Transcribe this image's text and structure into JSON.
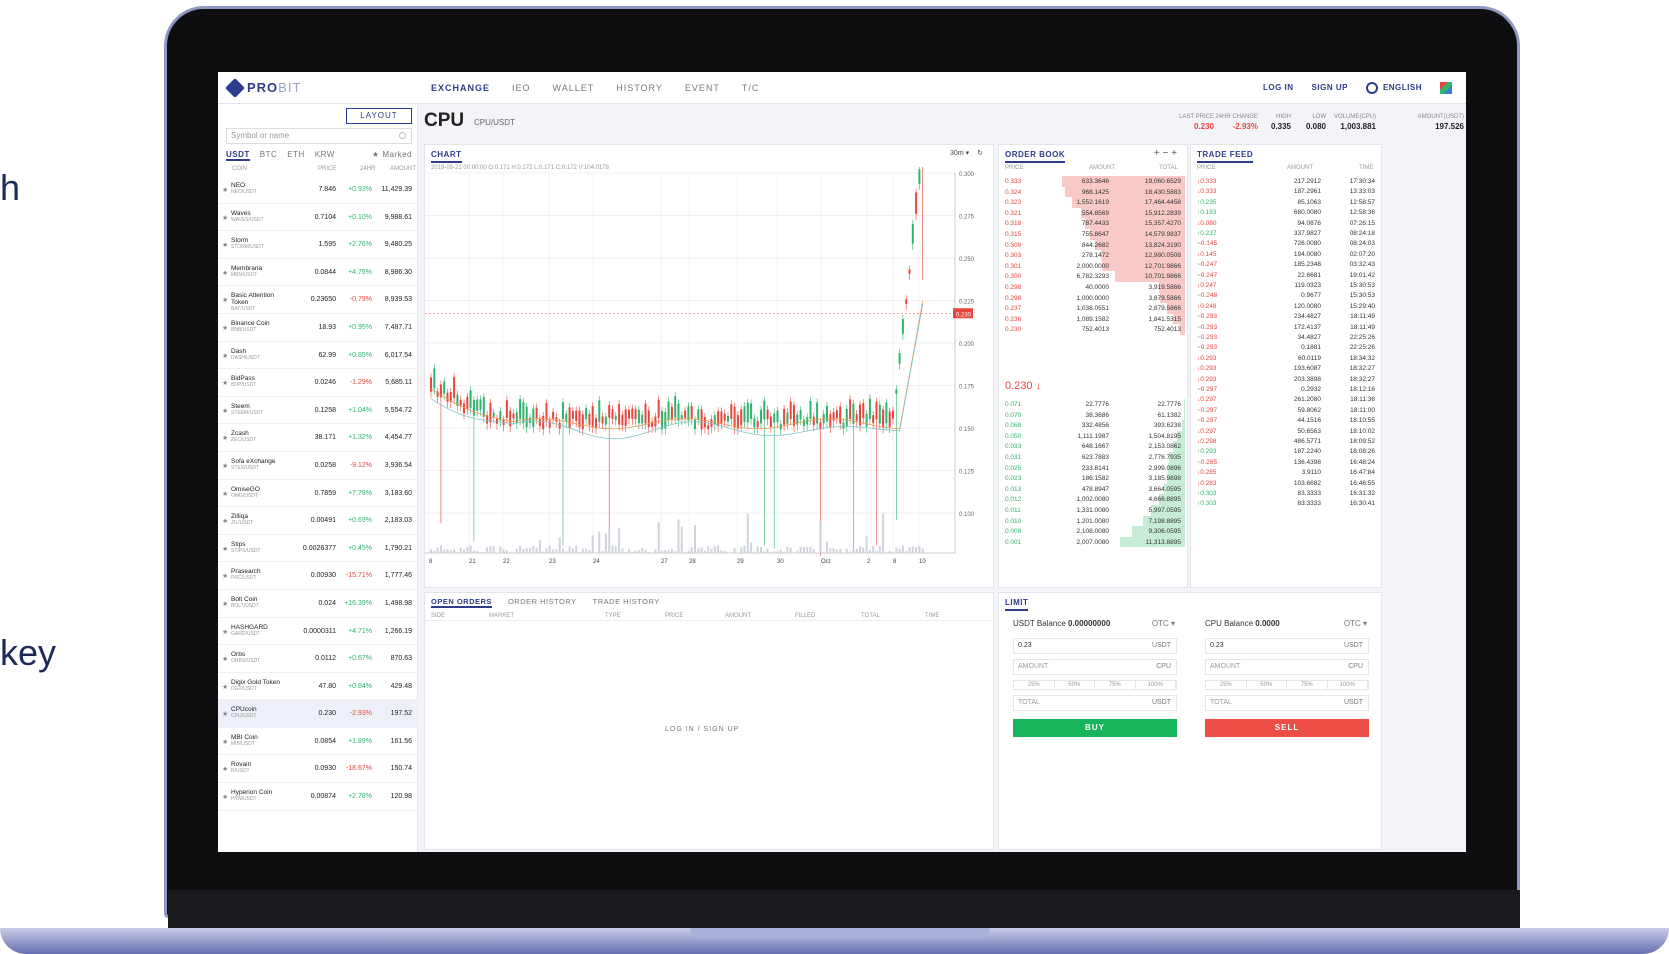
{
  "partial_side_text": {
    "line1": "h",
    "line2": "key"
  },
  "nav": {
    "logo_a": "PRO",
    "logo_b": "BIT",
    "tabs": [
      "EXCHANGE",
      "IEO",
      "WALLET",
      "HISTORY",
      "EVENT",
      "T/C"
    ],
    "login": "LOG IN",
    "signup": "SIGN UP",
    "language": "ENGLISH"
  },
  "markets": {
    "layout_button": "LAYOUT",
    "search_placeholder": "Symbol or name",
    "tabs": [
      "USDT",
      "BTC",
      "ETH",
      "KRW"
    ],
    "marked": "Marked",
    "headers": {
      "coin": "COIN",
      "price": "PRICE",
      "change": "24HR",
      "amount": "AMOUNT"
    },
    "coins": [
      {
        "name": "NEO",
        "pair": "NEO/USDT",
        "price": "7.846",
        "change": "+0.93%",
        "amount": "11,429.39",
        "dir": "up"
      },
      {
        "name": "Waves",
        "pair": "WAVES/USDT",
        "price": "0.7104",
        "change": "+0.10%",
        "amount": "9,988.61",
        "dir": "up"
      },
      {
        "name": "Storm",
        "pair": "STORM/USDT",
        "price": "1.595",
        "change": "+2.76%",
        "amount": "9,480.25",
        "dir": "up"
      },
      {
        "name": "Membrana",
        "pair": "MBN/USDT",
        "price": "0.0844",
        "change": "+4.76%",
        "amount": "8,986.30",
        "dir": "up"
      },
      {
        "name": "Basic Attention Token",
        "pair": "BAT/USDT",
        "price": "0.23650",
        "change": "-0.79%",
        "amount": "8,939.53",
        "dir": "dn"
      },
      {
        "name": "Binance Coin",
        "pair": "BNB/USDT",
        "price": "18.93",
        "change": "+0.95%",
        "amount": "7,487.71",
        "dir": "up"
      },
      {
        "name": "Dash",
        "pair": "DASH/USDT",
        "price": "62.99",
        "change": "+0.85%",
        "amount": "6,017.54",
        "dir": "up"
      },
      {
        "name": "BidPass",
        "pair": "BDP/USDT",
        "price": "0.0246",
        "change": "-1.29%",
        "amount": "5,685.11",
        "dir": "dn"
      },
      {
        "name": "Steem",
        "pair": "STEEM/USDT",
        "price": "0.1258",
        "change": "+1.04%",
        "amount": "5,554.72",
        "dir": "up"
      },
      {
        "name": "Zcash",
        "pair": "ZEC/USDT",
        "price": "38.171",
        "change": "+1.32%",
        "amount": "4,454.77",
        "dir": "up"
      },
      {
        "name": "Sofa eXchange",
        "pair": "STEX/USDT",
        "price": "0.0258",
        "change": "-9.12%",
        "amount": "3,936.54",
        "dir": "dn"
      },
      {
        "name": "OmiseGO",
        "pair": "OMG/USDT",
        "price": "0.7859",
        "change": "+7.78%",
        "amount": "3,183.60",
        "dir": "up"
      },
      {
        "name": "Zilliqa",
        "pair": "ZIL/USDT",
        "price": "0.00491",
        "change": "+0.69%",
        "amount": "2,183.03",
        "dir": "up"
      },
      {
        "name": "Stips",
        "pair": "STIPS/USDT",
        "price": "0.0026377",
        "change": "+0.45%",
        "amount": "1,790.21",
        "dir": "up"
      },
      {
        "name": "Prasearch",
        "pair": "PRC/USDT",
        "price": "0.00930",
        "change": "-15.71%",
        "amount": "1,777.46",
        "dir": "dn"
      },
      {
        "name": "Bolt Coin",
        "pair": "BOLT/USDT",
        "price": "0.024",
        "change": "+16.39%",
        "amount": "1,498.98",
        "dir": "up"
      },
      {
        "name": "HASHGARD",
        "pair": "GARD/USDT",
        "price": "0.0000311",
        "change": "+4.71%",
        "amount": "1,266.19",
        "dir": "up"
      },
      {
        "name": "Orbs",
        "pair": "ORBS/USDT",
        "price": "0.0112",
        "change": "+0.67%",
        "amount": "870.63",
        "dir": "up"
      },
      {
        "name": "Digix Gold Token",
        "pair": "DGX/USDT",
        "price": "47.80",
        "change": "+0.84%",
        "amount": "429.48",
        "dir": "up"
      },
      {
        "name": "CPUcoin",
        "pair": "CPU/USDT",
        "price": "0.230",
        "change": "-2.93%",
        "amount": "197.52",
        "dir": "dn"
      },
      {
        "name": "MBI Coin",
        "pair": "MIB/USDT",
        "price": "0.0854",
        "change": "+1.89%",
        "amount": "161.56",
        "dir": "up"
      },
      {
        "name": "Rovain",
        "pair": "R/USDT",
        "price": "0.0930",
        "change": "-18.67%",
        "amount": "150.74",
        "dir": "dn"
      },
      {
        "name": "Hyperion Coin",
        "pair": "HYN/USDT",
        "price": "0.00874",
        "change": "+2.78%",
        "amount": "120.98",
        "dir": "up"
      }
    ]
  },
  "ticker": {
    "symbol": "CPU",
    "pair": "CPU/USDT",
    "stats": [
      {
        "label": "LAST PRICE",
        "value": "0.230",
        "red": true
      },
      {
        "label": "24HR CHANGE",
        "value": "-2.93%",
        "red": true
      },
      {
        "label": "HIGH",
        "value": "0.335",
        "red": false
      },
      {
        "label": "LOW",
        "value": "0.080",
        "red": false
      },
      {
        "label": "VOLUME(CPU)",
        "value": "1,003.881",
        "red": false
      },
      {
        "label": "AMOUNT(USDT)",
        "value": "197.526",
        "red": false
      }
    ]
  },
  "chart": {
    "title": "CHART",
    "info": "2019-09-21 00:00:00  O:0.171  H:0.172  L:0.171  C:0.172  V:104.0178",
    "interval": "30m",
    "price_tag": "0.230",
    "y_ticks": [
      "0.300",
      "0.275",
      "0.250",
      "0.225",
      "0.200",
      "0.175",
      "0.150",
      "0.125",
      "0.100"
    ],
    "x_ticks": [
      "8",
      "21",
      "22",
      "23",
      "24",
      "27",
      "28",
      "29",
      "30",
      "Oct",
      "2",
      "8",
      "10"
    ]
  },
  "orderbook": {
    "title": "ORDER BOOK",
    "headers": {
      "price": "PRICE",
      "amount": "AMOUNT",
      "total": "TOTAL"
    },
    "asks": [
      {
        "p": "0.333",
        "a": "633.3646",
        "t": "19,060.6529",
        "d": 0.95
      },
      {
        "p": "0.324",
        "a": "968.1425",
        "t": "18,430.5883",
        "d": 0.92
      },
      {
        "p": "0.323",
        "a": "1,552.1619",
        "t": "17,464.4458",
        "d": 0.87
      },
      {
        "p": "0.321",
        "a": "554.8569",
        "t": "15,912.2839",
        "d": 0.8
      },
      {
        "p": "0.318",
        "a": "787.4433",
        "t": "15,357.4270",
        "d": 0.77
      },
      {
        "p": "0.315",
        "a": "755.8647",
        "t": "14,579.9837",
        "d": 0.73
      },
      {
        "p": "0.309",
        "a": "844.2682",
        "t": "13,824.3190",
        "d": 0.69
      },
      {
        "p": "0.303",
        "a": "278.1472",
        "t": "12,980.0508",
        "d": 0.65
      },
      {
        "p": "0.301",
        "a": "2,000.0000",
        "t": "12,701.9866",
        "d": 0.64
      },
      {
        "p": "0.300",
        "a": "6,782.3293",
        "t": "10,701.9866",
        "d": 0.54
      },
      {
        "p": "0.298",
        "a": "40.0000",
        "t": "3,919.5866",
        "d": 0.2
      },
      {
        "p": "0.298",
        "a": "1,000.0000",
        "t": "3,879.5866",
        "d": 0.19
      },
      {
        "p": "0.237",
        "a": "1,038.0551",
        "t": "2,879.5866",
        "d": 0.14
      },
      {
        "p": "0.236",
        "a": "1,089.1582",
        "t": "1,841.5315",
        "d": 0.09
      },
      {
        "p": "0.230",
        "a": "752.4013",
        "t": "752.4013",
        "d": 0.04
      }
    ],
    "mid": "0.230",
    "bids": [
      {
        "p": "0.071",
        "a": "22.7776",
        "t": "22.7776",
        "d": 0.01
      },
      {
        "p": "0.070",
        "a": "38.3686",
        "t": "61.1382",
        "d": 0.01
      },
      {
        "p": "0.068",
        "a": "332.4856",
        "t": "393.6238",
        "d": 0.02
      },
      {
        "p": "0.050",
        "a": "1,111.1987",
        "t": "1,504.8195",
        "d": 0.06
      },
      {
        "p": "0.033",
        "a": "648.1667",
        "t": "2,153.0862",
        "d": 0.09
      },
      {
        "p": "0.031",
        "a": "623.7883",
        "t": "2,776.7935",
        "d": 0.12
      },
      {
        "p": "0.025",
        "a": "233.8141",
        "t": "2,999.0896",
        "d": 0.13
      },
      {
        "p": "0.023",
        "a": "186.1582",
        "t": "3,185.9898",
        "d": 0.14
      },
      {
        "p": "0.013",
        "a": "478.8947",
        "t": "3,664.0595",
        "d": 0.16
      },
      {
        "p": "0.012",
        "a": "1,002.0080",
        "t": "4,666.8895",
        "d": 0.2
      },
      {
        "p": "0.011",
        "a": "1,331.0080",
        "t": "5,997.0595",
        "d": 0.26
      },
      {
        "p": "0.010",
        "a": "1,201.0080",
        "t": "7,198.8895",
        "d": 0.32
      },
      {
        "p": "0.008",
        "a": "2,108.0080",
        "t": "9,306.0595",
        "d": 0.41
      },
      {
        "p": "0.001",
        "a": "2,007.0080",
        "t": "11,313.8895",
        "d": 0.5
      }
    ]
  },
  "tradefeed": {
    "title": "TRADE FEED",
    "headers": {
      "price": "PRICE",
      "amount": "AMOUNT",
      "time": "TIME"
    },
    "rows": [
      {
        "p": "0.333",
        "a": "217.2912",
        "t": "17:30:34",
        "s": "d"
      },
      {
        "p": "0.333",
        "a": "187.2961",
        "t": "13:33:03",
        "s": "d"
      },
      {
        "p": "0.235",
        "a": "85.1063",
        "t": "12:58:57",
        "s": "u"
      },
      {
        "p": "0.193",
        "a": "680.0080",
        "t": "12:58:36",
        "s": "u"
      },
      {
        "p": "0.080",
        "a": "94.0876",
        "t": "07:26:15",
        "s": "d"
      },
      {
        "p": "0.237",
        "a": "337.9827",
        "t": "08:24:18",
        "s": "u"
      },
      {
        "p": "0.145",
        "a": "726.0080",
        "t": "08:24:03",
        "s": "n"
      },
      {
        "p": "0.145",
        "a": "194.0080",
        "t": "02:07:20",
        "s": "d"
      },
      {
        "p": "0.247",
        "a": "185.2348",
        "t": "03:32:43",
        "s": "n"
      },
      {
        "p": "0.247",
        "a": "22.6681",
        "t": "19:01:42",
        "s": "n"
      },
      {
        "p": "0.247",
        "a": "119.0323",
        "t": "15:30:53",
        "s": "d"
      },
      {
        "p": "0.248",
        "a": "0.9677",
        "t": "15:30:53",
        "s": "n"
      },
      {
        "p": "0.248",
        "a": "120.0080",
        "t": "15:29:40",
        "s": "d"
      },
      {
        "p": "0.293",
        "a": "234.4827",
        "t": "18:11:49",
        "s": "n"
      },
      {
        "p": "0.293",
        "a": "172.4137",
        "t": "18:11:49",
        "s": "n"
      },
      {
        "p": "0.293",
        "a": "34.4827",
        "t": "22:25:26",
        "s": "n"
      },
      {
        "p": "0.293",
        "a": "0.1881",
        "t": "22:25:26",
        "s": "n"
      },
      {
        "p": "0.293",
        "a": "60.0119",
        "t": "18:34:32",
        "s": "d"
      },
      {
        "p": "0.293",
        "a": "193.6087",
        "t": "18:32:27",
        "s": "d"
      },
      {
        "p": "0.293",
        "a": "203.3898",
        "t": "18:32:27",
        "s": "d"
      },
      {
        "p": "0.297",
        "a": "0.2932",
        "t": "18:12:16",
        "s": "n"
      },
      {
        "p": "0.297",
        "a": "261.2080",
        "t": "18:11:36",
        "s": "d"
      },
      {
        "p": "0.297",
        "a": "59.8062",
        "t": "18:11:00",
        "s": "n"
      },
      {
        "p": "0.297",
        "a": "44.1516",
        "t": "18:10:55",
        "s": "n"
      },
      {
        "p": "0.297",
        "a": "50.6563",
        "t": "18:10:02",
        "s": "d"
      },
      {
        "p": "0.298",
        "a": "486.5771",
        "t": "18:09:52",
        "s": "d"
      },
      {
        "p": "0.293",
        "a": "187.2240",
        "t": "18:08:26",
        "s": "u"
      },
      {
        "p": "0.285",
        "a": "136.4398",
        "t": "16:48:24",
        "s": "n"
      },
      {
        "p": "0.285",
        "a": "3.9110",
        "t": "16:47:84",
        "s": "d"
      },
      {
        "p": "0.283",
        "a": "103.6682",
        "t": "16:46:55",
        "s": "d"
      },
      {
        "p": "0.303",
        "a": "83.3333",
        "t": "16:31:32",
        "s": "u"
      },
      {
        "p": "0.303",
        "a": "83.3333",
        "t": "16:30:41",
        "s": "u"
      }
    ]
  },
  "orders": {
    "tabs": [
      "OPEN ORDERS",
      "ORDER HISTORY",
      "TRADE HISTORY"
    ],
    "headers": [
      "SIDE",
      "MARKET",
      "TYPE",
      "PRICE",
      "AMOUNT",
      "FILLED",
      "TOTAL",
      "TIME"
    ],
    "message": "LOG IN  /  SIGN UP"
  },
  "limit": {
    "title": "LIMIT",
    "buy": {
      "balance_label": "USDT Balance",
      "balance": "0.00000000",
      "otc": "OTC",
      "price": "0.23",
      "price_unit": "USDT",
      "amount": "AMOUNT",
      "amount_unit": "CPU",
      "total": "TOTAL",
      "total_unit": "USDT",
      "button": "BUY"
    },
    "sell": {
      "balance_label": "CPU Balance",
      "balance": "0.0000",
      "otc": "OTC",
      "price": "0.23",
      "price_unit": "USDT",
      "amount": "AMOUNT",
      "amount_unit": "CPU",
      "total": "TOTAL",
      "total_unit": "USDT",
      "button": "SELL"
    },
    "pcts": [
      "25%",
      "50%",
      "75%",
      "100%"
    ]
  },
  "colors": {
    "brand": "#2d3c8c",
    "up": "#2fb36d",
    "down": "#e8453c",
    "buy": "#17b45c",
    "sell": "#ec4d44"
  }
}
